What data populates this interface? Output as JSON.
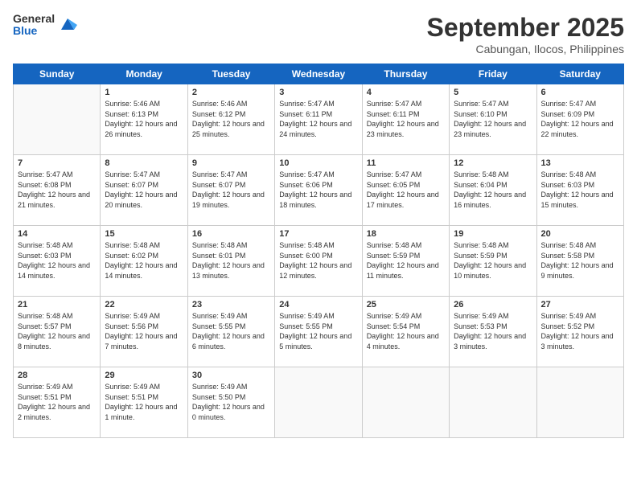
{
  "logo": {
    "general": "General",
    "blue": "Blue"
  },
  "title": "September 2025",
  "location": "Cabungan, Ilocos, Philippines",
  "days": [
    "Sunday",
    "Monday",
    "Tuesday",
    "Wednesday",
    "Thursday",
    "Friday",
    "Saturday"
  ],
  "weeks": [
    [
      {
        "date": "",
        "content": ""
      },
      {
        "date": "1",
        "sunrise": "Sunrise: 5:46 AM",
        "sunset": "Sunset: 6:13 PM",
        "daylight": "Daylight: 12 hours and 26 minutes."
      },
      {
        "date": "2",
        "sunrise": "Sunrise: 5:46 AM",
        "sunset": "Sunset: 6:12 PM",
        "daylight": "Daylight: 12 hours and 25 minutes."
      },
      {
        "date": "3",
        "sunrise": "Sunrise: 5:47 AM",
        "sunset": "Sunset: 6:11 PM",
        "daylight": "Daylight: 12 hours and 24 minutes."
      },
      {
        "date": "4",
        "sunrise": "Sunrise: 5:47 AM",
        "sunset": "Sunset: 6:11 PM",
        "daylight": "Daylight: 12 hours and 23 minutes."
      },
      {
        "date": "5",
        "sunrise": "Sunrise: 5:47 AM",
        "sunset": "Sunset: 6:10 PM",
        "daylight": "Daylight: 12 hours and 23 minutes."
      },
      {
        "date": "6",
        "sunrise": "Sunrise: 5:47 AM",
        "sunset": "Sunset: 6:09 PM",
        "daylight": "Daylight: 12 hours and 22 minutes."
      }
    ],
    [
      {
        "date": "7",
        "sunrise": "Sunrise: 5:47 AM",
        "sunset": "Sunset: 6:08 PM",
        "daylight": "Daylight: 12 hours and 21 minutes."
      },
      {
        "date": "8",
        "sunrise": "Sunrise: 5:47 AM",
        "sunset": "Sunset: 6:07 PM",
        "daylight": "Daylight: 12 hours and 20 minutes."
      },
      {
        "date": "9",
        "sunrise": "Sunrise: 5:47 AM",
        "sunset": "Sunset: 6:07 PM",
        "daylight": "Daylight: 12 hours and 19 minutes."
      },
      {
        "date": "10",
        "sunrise": "Sunrise: 5:47 AM",
        "sunset": "Sunset: 6:06 PM",
        "daylight": "Daylight: 12 hours and 18 minutes."
      },
      {
        "date": "11",
        "sunrise": "Sunrise: 5:47 AM",
        "sunset": "Sunset: 6:05 PM",
        "daylight": "Daylight: 12 hours and 17 minutes."
      },
      {
        "date": "12",
        "sunrise": "Sunrise: 5:48 AM",
        "sunset": "Sunset: 6:04 PM",
        "daylight": "Daylight: 12 hours and 16 minutes."
      },
      {
        "date": "13",
        "sunrise": "Sunrise: 5:48 AM",
        "sunset": "Sunset: 6:03 PM",
        "daylight": "Daylight: 12 hours and 15 minutes."
      }
    ],
    [
      {
        "date": "14",
        "sunrise": "Sunrise: 5:48 AM",
        "sunset": "Sunset: 6:03 PM",
        "daylight": "Daylight: 12 hours and 14 minutes."
      },
      {
        "date": "15",
        "sunrise": "Sunrise: 5:48 AM",
        "sunset": "Sunset: 6:02 PM",
        "daylight": "Daylight: 12 hours and 14 minutes."
      },
      {
        "date": "16",
        "sunrise": "Sunrise: 5:48 AM",
        "sunset": "Sunset: 6:01 PM",
        "daylight": "Daylight: 12 hours and 13 minutes."
      },
      {
        "date": "17",
        "sunrise": "Sunrise: 5:48 AM",
        "sunset": "Sunset: 6:00 PM",
        "daylight": "Daylight: 12 hours and 12 minutes."
      },
      {
        "date": "18",
        "sunrise": "Sunrise: 5:48 AM",
        "sunset": "Sunset: 5:59 PM",
        "daylight": "Daylight: 12 hours and 11 minutes."
      },
      {
        "date": "19",
        "sunrise": "Sunrise: 5:48 AM",
        "sunset": "Sunset: 5:59 PM",
        "daylight": "Daylight: 12 hours and 10 minutes."
      },
      {
        "date": "20",
        "sunrise": "Sunrise: 5:48 AM",
        "sunset": "Sunset: 5:58 PM",
        "daylight": "Daylight: 12 hours and 9 minutes."
      }
    ],
    [
      {
        "date": "21",
        "sunrise": "Sunrise: 5:48 AM",
        "sunset": "Sunset: 5:57 PM",
        "daylight": "Daylight: 12 hours and 8 minutes."
      },
      {
        "date": "22",
        "sunrise": "Sunrise: 5:49 AM",
        "sunset": "Sunset: 5:56 PM",
        "daylight": "Daylight: 12 hours and 7 minutes."
      },
      {
        "date": "23",
        "sunrise": "Sunrise: 5:49 AM",
        "sunset": "Sunset: 5:55 PM",
        "daylight": "Daylight: 12 hours and 6 minutes."
      },
      {
        "date": "24",
        "sunrise": "Sunrise: 5:49 AM",
        "sunset": "Sunset: 5:55 PM",
        "daylight": "Daylight: 12 hours and 5 minutes."
      },
      {
        "date": "25",
        "sunrise": "Sunrise: 5:49 AM",
        "sunset": "Sunset: 5:54 PM",
        "daylight": "Daylight: 12 hours and 4 minutes."
      },
      {
        "date": "26",
        "sunrise": "Sunrise: 5:49 AM",
        "sunset": "Sunset: 5:53 PM",
        "daylight": "Daylight: 12 hours and 3 minutes."
      },
      {
        "date": "27",
        "sunrise": "Sunrise: 5:49 AM",
        "sunset": "Sunset: 5:52 PM",
        "daylight": "Daylight: 12 hours and 3 minutes."
      }
    ],
    [
      {
        "date": "28",
        "sunrise": "Sunrise: 5:49 AM",
        "sunset": "Sunset: 5:51 PM",
        "daylight": "Daylight: 12 hours and 2 minutes."
      },
      {
        "date": "29",
        "sunrise": "Sunrise: 5:49 AM",
        "sunset": "Sunset: 5:51 PM",
        "daylight": "Daylight: 12 hours and 1 minute."
      },
      {
        "date": "30",
        "sunrise": "Sunrise: 5:49 AM",
        "sunset": "Sunset: 5:50 PM",
        "daylight": "Daylight: 12 hours and 0 minutes."
      },
      {
        "date": "",
        "content": ""
      },
      {
        "date": "",
        "content": ""
      },
      {
        "date": "",
        "content": ""
      },
      {
        "date": "",
        "content": ""
      }
    ]
  ]
}
